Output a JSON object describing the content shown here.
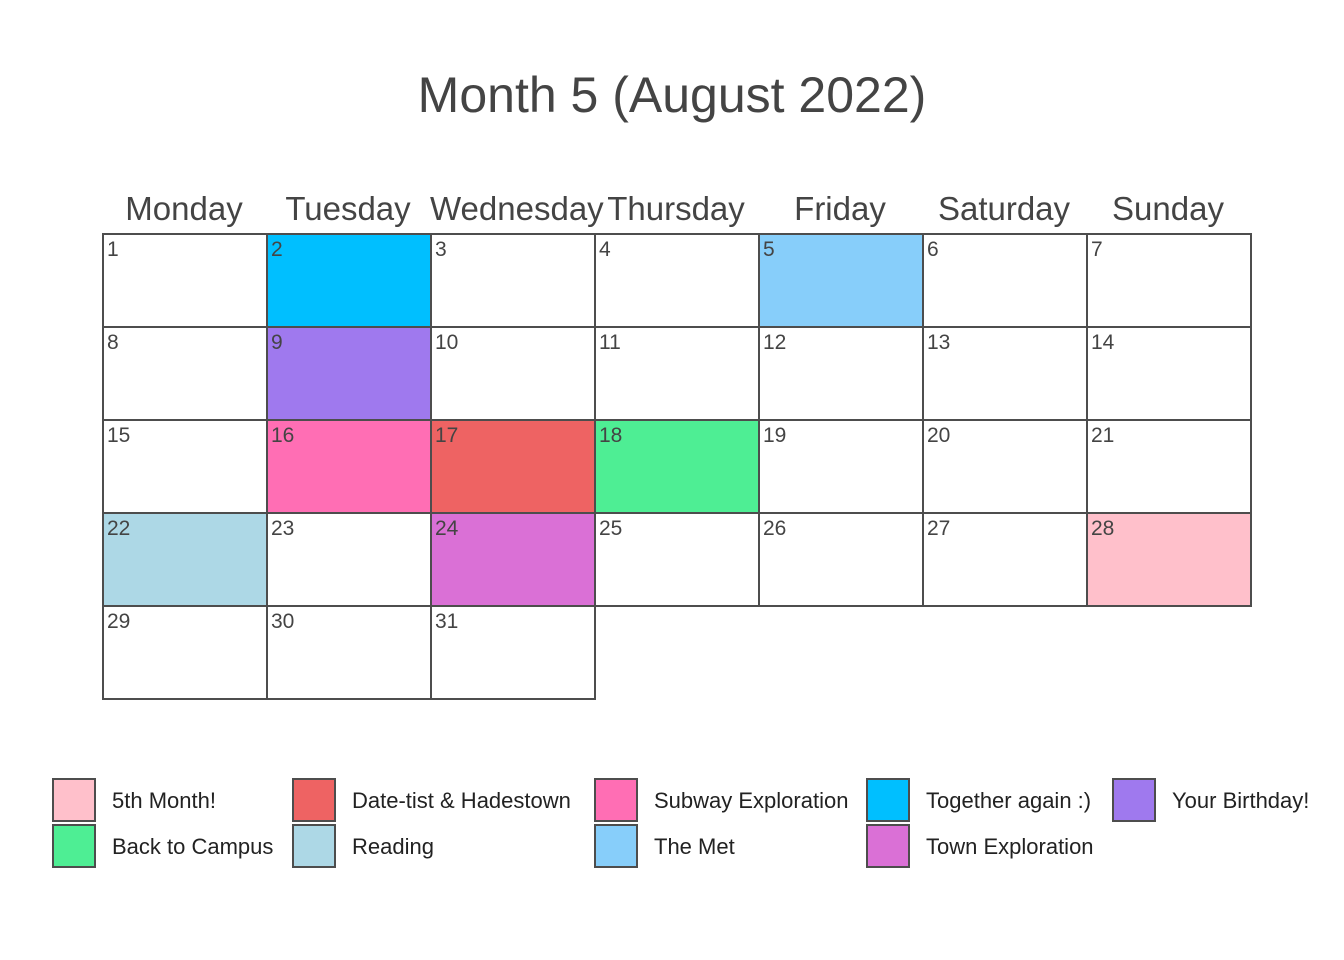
{
  "title": "Month 5 (August 2022)",
  "weekdays": [
    "Monday",
    "Tuesday",
    "Wednesday",
    "Thursday",
    "Friday",
    "Saturday",
    "Sunday"
  ],
  "chart_data": {
    "type": "table",
    "month": "August 2022",
    "first_weekday": "Monday",
    "days_in_month": 31,
    "events": [
      {
        "day": 2,
        "event": "Together again :)"
      },
      {
        "day": 5,
        "event": "The Met"
      },
      {
        "day": 9,
        "event": "Your Birthday!"
      },
      {
        "day": 16,
        "event": "Subway Exploration"
      },
      {
        "day": 17,
        "event": "Date-tist & Hadestown"
      },
      {
        "day": 18,
        "event": "Back to Campus"
      },
      {
        "day": 22,
        "event": "Reading"
      },
      {
        "day": 24,
        "event": "Town Exploration"
      },
      {
        "day": 28,
        "event": "5th Month!"
      }
    ],
    "legend": [
      {
        "label": "5th Month!",
        "color": "#FFC0CB"
      },
      {
        "label": "Back to Campus",
        "color": "#4EEE94"
      },
      {
        "label": "Date-tist & Hadestown",
        "color": "#EE6363"
      },
      {
        "label": "Reading",
        "color": "#ADD8E6"
      },
      {
        "label": "Subway Exploration",
        "color": "#FF6EB4"
      },
      {
        "label": "The Met",
        "color": "#87CEFA"
      },
      {
        "label": "Together again :)",
        "color": "#00BFFF"
      },
      {
        "label": "Town Exploration",
        "color": "#DA70D6"
      },
      {
        "label": "Your Birthday!",
        "color": "#9F79EE"
      }
    ]
  }
}
